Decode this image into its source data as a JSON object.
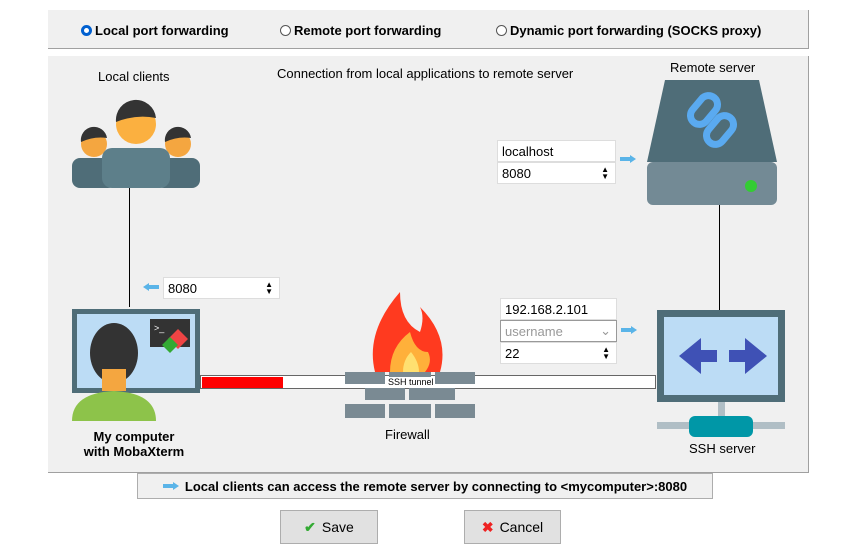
{
  "modes": [
    {
      "label": "Local port forwarding",
      "selected": true
    },
    {
      "label": "Remote port forwarding",
      "selected": false
    },
    {
      "label": "Dynamic port forwarding (SOCKS proxy)",
      "selected": false
    }
  ],
  "diagram": {
    "title": "Connection from local applications to remote server",
    "local_clients_label": "Local clients",
    "remote_server_label": "Remote server",
    "my_computer_label": "My computer\nwith MobaXterm",
    "firewall_label": "Firewall",
    "ssh_server_label": "SSH server",
    "tunnel_label": "SSH tunnel",
    "local_port": "8080",
    "remote_host": "localhost",
    "remote_port": "8080",
    "ssh_host": "192.168.2.101",
    "ssh_user_placeholder": "username",
    "ssh_port": "22"
  },
  "info_text": "Local clients can access the remote server by connecting to <mycomputer>:8080",
  "buttons": {
    "save": "Save",
    "cancel": "Cancel"
  },
  "colors": {
    "accent": "#0060d0",
    "tunnel_progress": "#ff0000",
    "server": "#4f6d78"
  }
}
